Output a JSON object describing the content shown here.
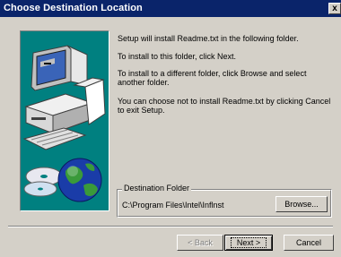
{
  "window": {
    "title": "Choose Destination Location",
    "close_label": "x"
  },
  "message": {
    "line1": "Setup will install Readme.txt in the following folder.",
    "line2": "To install to this folder, click Next.",
    "line3": "To install to a different folder, click Browse and select another folder.",
    "line4": "You can choose not to install Readme.txt by clicking Cancel to exit Setup."
  },
  "destination": {
    "group_label": "Destination Folder",
    "path": "C:\\Program Files\\Intel\\Inflnst",
    "browse_label": "Browse..."
  },
  "buttons": {
    "back_label": "< Back",
    "next_label": "Next >",
    "cancel_label": "Cancel"
  },
  "colors": {
    "titlebar": "#0a246a",
    "art_background": "#008080",
    "dialog_face": "#d4d0c8"
  },
  "icons": [
    "computer-icon",
    "compact-disc-icon",
    "globe-icon",
    "close-icon"
  ]
}
